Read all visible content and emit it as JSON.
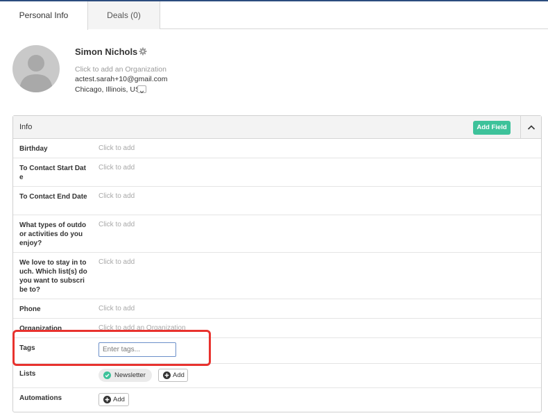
{
  "tabs": [
    {
      "label": "Personal Info"
    },
    {
      "label": "Deals (0)"
    }
  ],
  "contact": {
    "name": "Simon Nichols",
    "organization_placeholder": "Click to add an Organization",
    "email": "actest.sarah+10@gmail.com",
    "location": "Chicago, Illinois, US"
  },
  "panel": {
    "title": "Info",
    "add_field_label": "Add Field",
    "rows": [
      {
        "label": "Birthday",
        "value": "Click to add"
      },
      {
        "label": "To Contact Start Date",
        "value": "Click to add"
      },
      {
        "label": "To Contact End Date",
        "value": "Click to add"
      },
      {
        "label": "What types of outdoor activities do you enjoy?",
        "value": "Click to add"
      },
      {
        "label": "We love to stay in touch. Which list(s) do you want to subscribe to?",
        "value": "Click to add"
      },
      {
        "label": "Phone",
        "value": "Click to add"
      },
      {
        "label": "Organization",
        "value": "Click to add an Organization"
      },
      {
        "label": "Tags",
        "placeholder": "Enter tags..."
      },
      {
        "label": "Lists",
        "list_name": "Newsletter",
        "add_label": "Add"
      },
      {
        "label": "Automations",
        "add_label": "Add"
      }
    ]
  },
  "colors": {
    "accent_green": "#3dc29a",
    "highlight_red": "#e8322e",
    "top_bar": "#2b4c7e"
  }
}
